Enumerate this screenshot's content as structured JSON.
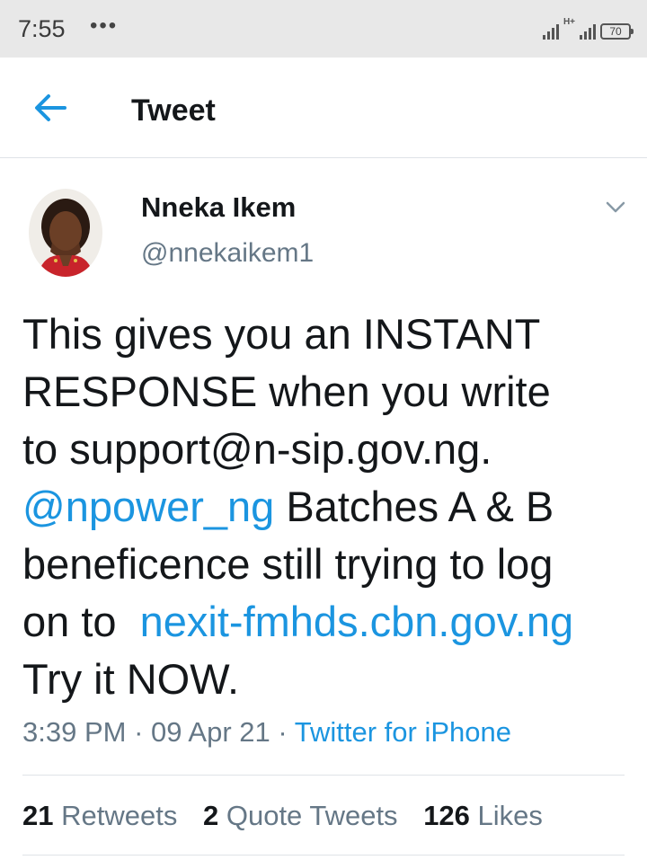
{
  "status_bar": {
    "time": "7:55",
    "dots": "•••",
    "network_label": "H+",
    "battery": "70"
  },
  "header": {
    "title": "Tweet"
  },
  "tweet": {
    "author_name": "Nneka Ikem",
    "author_handle": "@nnekaikem1",
    "text_lines": [
      [
        "This gives you an INSTANT"
      ],
      [
        "RESPONSE when you write"
      ],
      [
        "to support@n-sip.gov.ng."
      ],
      [
        "@npower_ng",
        " Batches A & B"
      ],
      [
        "beneficence still trying to log"
      ],
      [
        "on to ",
        "nexit-fmhds.cbn.gov.ng"
      ],
      [
        "Try it NOW."
      ]
    ],
    "time": "3:39 PM",
    "date": "09 Apr 21",
    "separator": "·",
    "source": "Twitter for iPhone"
  },
  "stats": {
    "retweets_count": "21",
    "retweets_label": "Retweets",
    "quotes_count": "2",
    "quotes_label": "Quote Tweets",
    "likes_count": "126",
    "likes_label": "Likes"
  },
  "colors": {
    "link": "#1b95e0",
    "secondary_text": "#657786",
    "primary_text": "#14171a",
    "status_bar_bg": "#e8e8e8"
  }
}
